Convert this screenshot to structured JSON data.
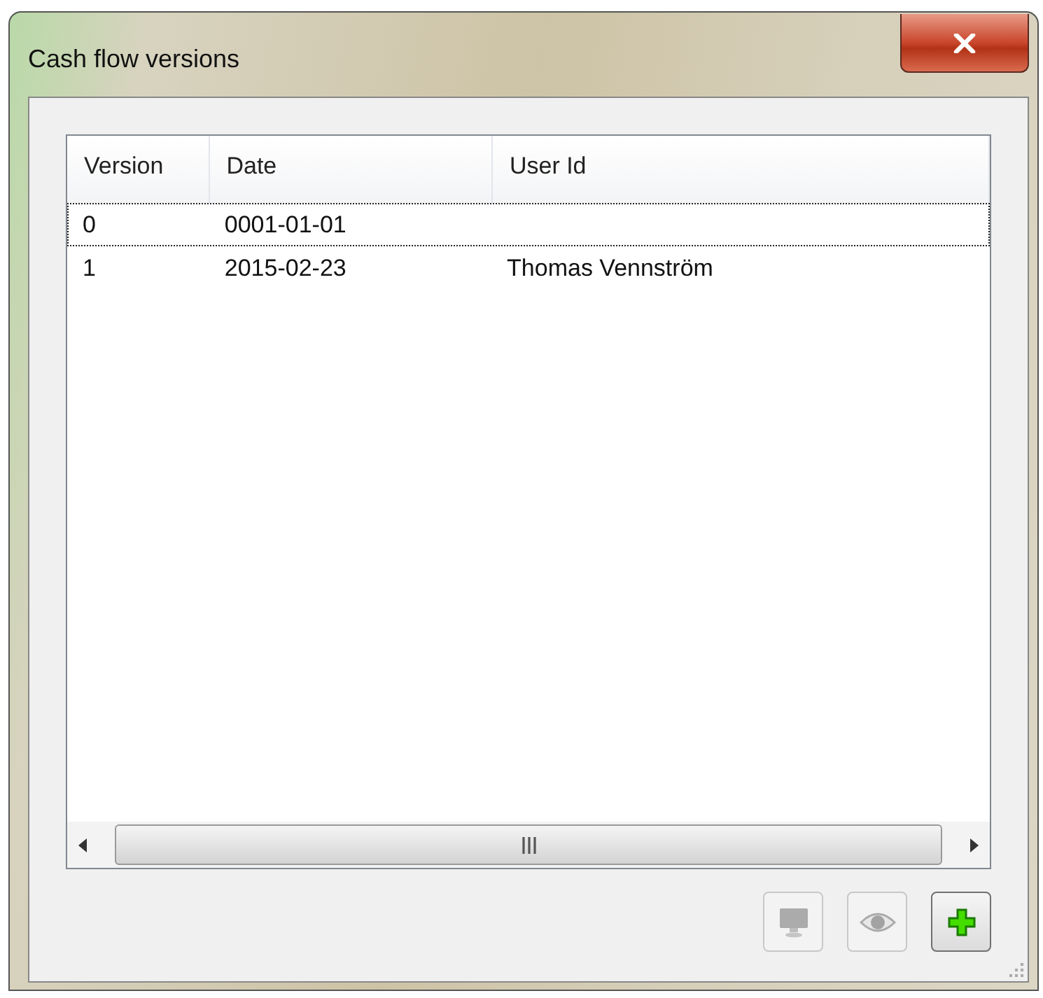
{
  "window": {
    "title": "Cash flow versions"
  },
  "table": {
    "columns": [
      "Version",
      "Date",
      "User Id"
    ],
    "rows": [
      {
        "cells": [
          "0",
          "0001-01-01",
          ""
        ],
        "focused": true
      },
      {
        "cells": [
          "1",
          "2015-02-23",
          "Thomas Vennström"
        ],
        "focused": false
      }
    ]
  },
  "buttons": [
    {
      "kind": "monitor",
      "disabled": true
    },
    {
      "kind": "eye",
      "disabled": true
    },
    {
      "kind": "add",
      "disabled": false
    }
  ]
}
